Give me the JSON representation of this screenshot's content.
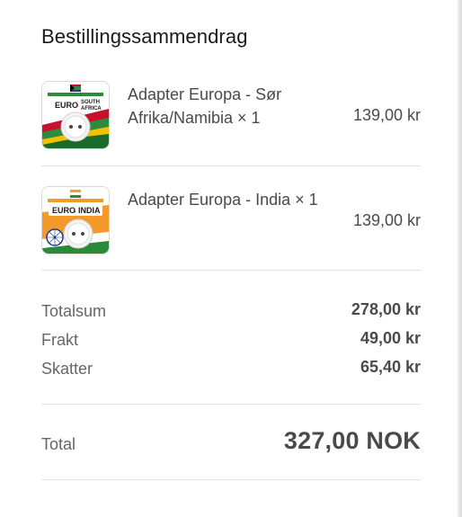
{
  "summary": {
    "title": "Bestillingssammendrag"
  },
  "items": [
    {
      "name": "Adapter Europa - Sør Afrika/Namibia × 1",
      "price": "139,00 kr",
      "image": {
        "kind": "adapter-south-africa",
        "badge_left": "EURO",
        "badge_right_line1": "SOUTH",
        "badge_right_line2": "AFRICA"
      }
    },
    {
      "name": "Adapter Europa - India × 1",
      "price": "139,00 kr",
      "image": {
        "kind": "adapter-india",
        "badge_left": "EURO",
        "badge_right_line1": "INDIA"
      }
    }
  ],
  "totals": {
    "subtotal_label": "Totalsum",
    "subtotal_value": "278,00 kr",
    "shipping_label": "Frakt",
    "shipping_value": "49,00 kr",
    "tax_label": "Skatter",
    "tax_value": "65,40 kr",
    "total_label": "Total",
    "total_value": "327,00 NOK"
  },
  "colors": {
    "text_dark": "#1a1a1a",
    "text_medium": "#4a4a4a",
    "text_muted": "#666666",
    "divider": "#e2e2e2",
    "sa_green": "#2e8b3e",
    "sa_red": "#c8102e",
    "sa_yellow": "#f2c200",
    "india_saffron": "#f39a2b",
    "india_green": "#2a8a3a",
    "india_blue": "#1f3b8c"
  }
}
